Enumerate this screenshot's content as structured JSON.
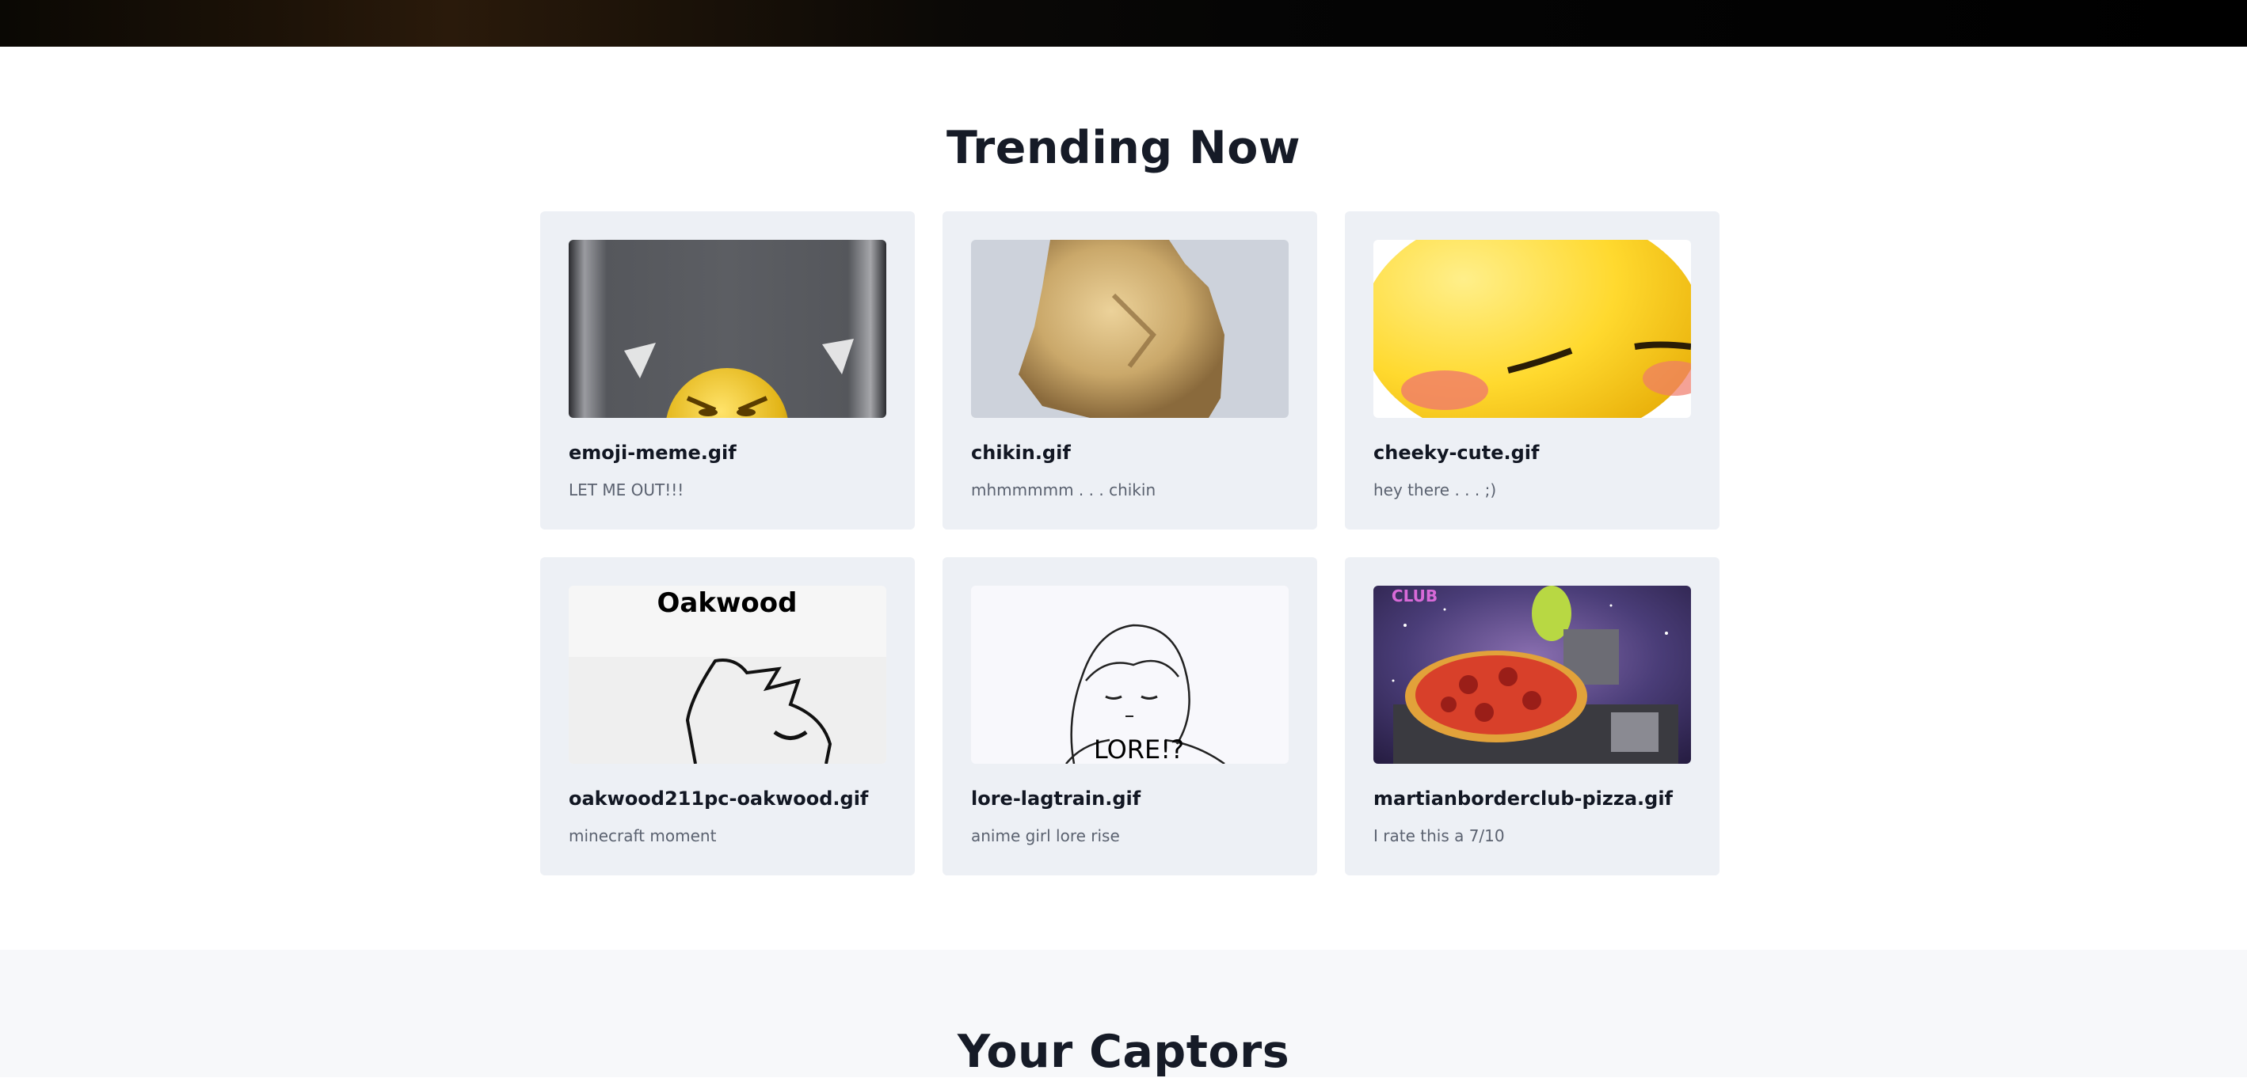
{
  "trending": {
    "title": "Trending Now",
    "cards": [
      {
        "name": "emoji-meme.gif",
        "description": "LET ME OUT!!!",
        "thumb_icon": "angry-emoji-in-box-image"
      },
      {
        "name": "chikin.gif",
        "description": "mhmmmmm . . . chikin",
        "thumb_icon": "fried-chicken-image"
      },
      {
        "name": "cheeky-cute.gif",
        "description": "hey there . . . ;)",
        "thumb_icon": "blushing-emoji-image"
      },
      {
        "name": "oakwood211pc-oakwood.gif",
        "description": "minecraft moment",
        "thumb_icon": "oakwood-cat-sketch-image",
        "thumb_text": "Oakwood"
      },
      {
        "name": "lore-lagtrain.gif",
        "description": "anime girl lore rise",
        "thumb_icon": "anime-girl-sketch-image",
        "thumb_text": "LORE!?"
      },
      {
        "name": "martianborderclub-pizza.gif",
        "description": "I rate this a 7/10",
        "thumb_icon": "alien-dj-pizza-image",
        "thumb_text": "CLUB"
      }
    ]
  },
  "captors": {
    "title": "Your Captors"
  }
}
